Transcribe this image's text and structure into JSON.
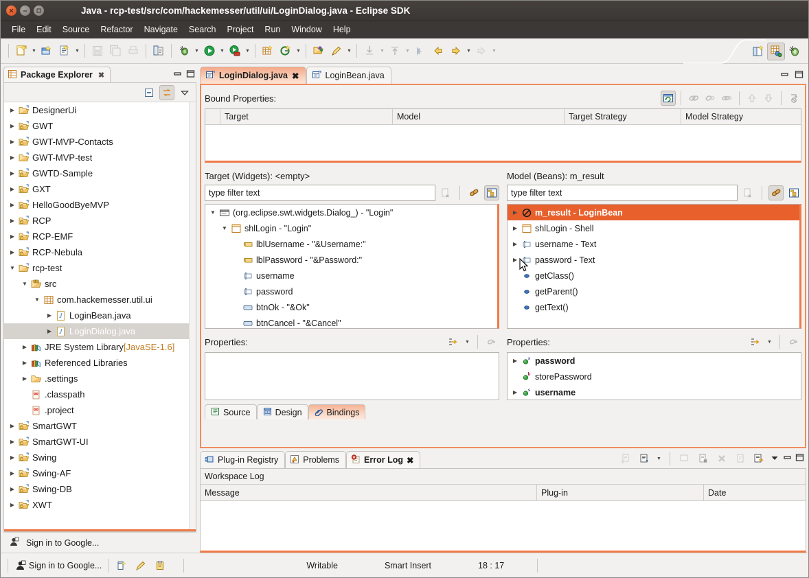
{
  "window": {
    "title": "Java - rcp-test/src/com/hackemesser/util/ui/LoginDialog.java - Eclipse SDK",
    "buttons": {
      "close": "close-window",
      "minimize": "minimize-window",
      "maximize": "maximize-window"
    }
  },
  "menubar": {
    "items": [
      "File",
      "Edit",
      "Source",
      "Refactor",
      "Navigate",
      "Search",
      "Project",
      "Run",
      "Window",
      "Help"
    ]
  },
  "toolbar": {
    "groups": [
      [
        "new-wizard",
        "new-wizard-dropdown",
        "new-java-package",
        "new-java-class",
        "new-java-class-dropdown"
      ],
      [
        "save",
        "save-all",
        "print"
      ],
      [
        "toggle-mark-occurrences"
      ],
      [
        "debug",
        "debug-dropdown",
        "run",
        "run-dropdown",
        "run-last-tool",
        "run-last-tool-dropdown"
      ],
      [
        "new-java-package-2",
        "new-annotation"
      ],
      [
        "open-type",
        "search",
        "search-dropdown"
      ],
      [
        "next-annotation",
        "next-annotation-dropdown",
        "previous-annotation",
        "previous-annotation-dropdown"
      ],
      [
        "back",
        "forward",
        "forward-dropdown"
      ]
    ],
    "right": [
      "open-perspective",
      "java-perspective-active",
      "debug-perspective"
    ]
  },
  "package_explorer": {
    "tab_label": "Package Explorer",
    "tab_icon": "package-explorer-icon",
    "close_icon": "close-icon",
    "minimize_icon": "minimize-icon",
    "maximize_icon": "maximize-icon",
    "toolbar": [
      "collapse-all-icon",
      "link-with-editor-icon",
      "view-menu-icon"
    ],
    "tree": [
      {
        "label": "DesignerUi",
        "icon": "project-open-icon",
        "indent": 0,
        "twisty": "collapsed",
        "selected": false
      },
      {
        "label": "GWT",
        "icon": "project-closed-icon",
        "indent": 0,
        "twisty": "collapsed",
        "selected": false
      },
      {
        "label": "GWT-MVP-Contacts",
        "icon": "project-closed-icon",
        "indent": 0,
        "twisty": "collapsed",
        "selected": false
      },
      {
        "label": "GWT-MVP-test",
        "icon": "project-open-icon",
        "indent": 0,
        "twisty": "collapsed",
        "selected": false
      },
      {
        "label": "GWTD-Sample",
        "icon": "project-closed-icon",
        "indent": 0,
        "twisty": "collapsed",
        "selected": false
      },
      {
        "label": "GXT",
        "icon": "project-closed-icon",
        "indent": 0,
        "twisty": "collapsed",
        "selected": false
      },
      {
        "label": "HelloGoodByeMVP",
        "icon": "project-closed-icon",
        "indent": 0,
        "twisty": "collapsed",
        "selected": false
      },
      {
        "label": "RCP",
        "icon": "project-closed-icon",
        "indent": 0,
        "twisty": "collapsed",
        "selected": false
      },
      {
        "label": "RCP-EMF",
        "icon": "project-closed-icon",
        "indent": 0,
        "twisty": "collapsed",
        "selected": false
      },
      {
        "label": "RCP-Nebula",
        "icon": "project-closed-icon",
        "indent": 0,
        "twisty": "collapsed",
        "selected": false
      },
      {
        "label": "rcp-test",
        "icon": "project-open-icon",
        "indent": 0,
        "twisty": "expanded",
        "selected": false
      },
      {
        "label": "src",
        "icon": "source-folder-icon",
        "indent": 1,
        "twisty": "expanded",
        "selected": false
      },
      {
        "label": "com.hackemesser.util.ui",
        "icon": "package-icon",
        "indent": 2,
        "twisty": "expanded",
        "selected": false
      },
      {
        "label": "LoginBean.java",
        "icon": "java-file-icon",
        "indent": 3,
        "twisty": "collapsed",
        "selected": false
      },
      {
        "label": "LoginDialog.java",
        "icon": "java-file-icon",
        "indent": 3,
        "twisty": "collapsed",
        "selected": true
      },
      {
        "label": "JRE System Library ",
        "suffix": "[JavaSE-1.6]",
        "icon": "library-icon",
        "indent": 1,
        "twisty": "collapsed",
        "selected": false
      },
      {
        "label": "Referenced Libraries",
        "icon": "library-icon",
        "indent": 1,
        "twisty": "collapsed",
        "selected": false
      },
      {
        "label": ".settings",
        "icon": "folder-icon",
        "indent": 1,
        "twisty": "collapsed",
        "selected": false
      },
      {
        "label": ".classpath",
        "icon": "file-icon",
        "indent": 1,
        "twisty": "none",
        "selected": false
      },
      {
        "label": ".project",
        "icon": "file-icon",
        "indent": 1,
        "twisty": "none",
        "selected": false
      },
      {
        "label": "SmartGWT",
        "icon": "project-closed-icon",
        "indent": 0,
        "twisty": "collapsed",
        "selected": false
      },
      {
        "label": "SmartGWT-UI",
        "icon": "project-closed-icon",
        "indent": 0,
        "twisty": "collapsed",
        "selected": false
      },
      {
        "label": "Swing",
        "icon": "project-closed-icon",
        "indent": 0,
        "twisty": "collapsed",
        "selected": false
      },
      {
        "label": "Swing-AF",
        "icon": "project-closed-icon",
        "indent": 0,
        "twisty": "collapsed",
        "selected": false
      },
      {
        "label": "Swing-DB",
        "icon": "project-closed-icon",
        "indent": 0,
        "twisty": "collapsed",
        "selected": false
      },
      {
        "label": "XWT",
        "icon": "project-closed-icon",
        "indent": 0,
        "twisty": "collapsed",
        "selected": false
      }
    ],
    "footer": {
      "signin_label": "Sign in to Google...",
      "icons": [
        "new-snippet-icon",
        "pencil-icon",
        "clipboard-icon"
      ]
    }
  },
  "editor": {
    "tabs": [
      {
        "label": "LoginDialog.java",
        "icon": "java-editor-icon",
        "active": true,
        "close_icon": "close-icon"
      },
      {
        "label": "LoginBean.java",
        "icon": "java-editor-icon",
        "active": false
      }
    ],
    "controls": [
      "minimize-icon",
      "maximize-icon"
    ],
    "bound_properties": {
      "label": "Bound Properties:",
      "toolbar": [
        "refresh-icon",
        "edit-binding-icon",
        "remove-binding-icon",
        "remove-all-bindings-icon",
        "move-up-icon",
        "move-down-icon",
        "jump-to-icon"
      ],
      "columns": [
        "Target",
        "Model",
        "Target Strategy",
        "Model Strategy"
      ],
      "rows": []
    },
    "target": {
      "title": "Target (Widgets): <empty>",
      "filter_placeholder": "type filter text",
      "filter_value": "",
      "filter_tools": [
        "clear-filter-icon",
        "show-advanced-properties-icon",
        "show-tree-icon"
      ],
      "tree": [
        {
          "label": "(org.eclipse.swt.widgets.Dialog_) - \"Login\"",
          "icon": "dialog-icon",
          "indent": 0,
          "twisty": "expanded"
        },
        {
          "label": "shlLogin - \"Login\"",
          "icon": "shell-icon",
          "indent": 1,
          "twisty": "expanded"
        },
        {
          "label": "lblUsername - \"&Username:\"",
          "icon": "label-widget-icon",
          "indent": 2,
          "twisty": "none"
        },
        {
          "label": "lblPassword - \"&Password:\"",
          "icon": "label-widget-icon",
          "indent": 2,
          "twisty": "none"
        },
        {
          "label": "username",
          "icon": "text-widget-icon",
          "indent": 2,
          "twisty": "none"
        },
        {
          "label": "password",
          "icon": "text-widget-icon",
          "indent": 2,
          "twisty": "none"
        },
        {
          "label": "btnOk - \"&Ok\"",
          "icon": "button-widget-icon",
          "indent": 2,
          "twisty": "none"
        },
        {
          "label": "btnCancel - \"&Cancel\"",
          "icon": "button-widget-icon",
          "indent": 2,
          "twisty": "none"
        }
      ],
      "properties_label": "Properties:",
      "properties_tools": [
        "filter-properties-icon",
        "bind-icon"
      ],
      "properties": []
    },
    "model": {
      "title": "Model (Beans): m_result",
      "filter_placeholder": "type filter text",
      "filter_value": "",
      "filter_tools": [
        "clear-filter-icon",
        "show-advanced-properties-icon",
        "show-tree-icon"
      ],
      "tree": [
        {
          "label": "m_result - LoginBean",
          "icon": "bean-icon",
          "indent": 0,
          "twisty": "collapsed",
          "selected": true
        },
        {
          "label": "shlLogin - Shell",
          "icon": "shell-icon",
          "indent": 0,
          "twisty": "collapsed",
          "selected": false
        },
        {
          "label": "username - Text",
          "icon": "text-widget-icon",
          "indent": 0,
          "twisty": "collapsed",
          "selected": false
        },
        {
          "label": "password - Text",
          "icon": "text-widget-icon",
          "indent": 0,
          "twisty": "collapsed",
          "selected": false
        },
        {
          "label": "getClass()",
          "icon": "method-icon",
          "indent": 0,
          "twisty": "none",
          "selected": false
        },
        {
          "label": "getParent()",
          "icon": "method-icon",
          "indent": 0,
          "twisty": "none",
          "selected": false
        },
        {
          "label": "getText()",
          "icon": "method-icon",
          "indent": 0,
          "twisty": "none",
          "selected": false
        }
      ],
      "properties_label": "Properties:",
      "properties_tools": [
        "filter-properties-icon",
        "bind-icon"
      ],
      "properties": [
        {
          "label": "password",
          "icon": "property-string-icon",
          "badge": "s",
          "bold": true,
          "twisty": "collapsed"
        },
        {
          "label": "storePassword",
          "icon": "property-boolean-icon",
          "badge": "b",
          "bold": false,
          "twisty": "none"
        },
        {
          "label": "username",
          "icon": "property-string-icon",
          "badge": "s",
          "bold": true,
          "twisty": "collapsed"
        }
      ]
    },
    "bottom_tabs": [
      {
        "label": "Source",
        "icon": "source-tab-icon",
        "active": false
      },
      {
        "label": "Design",
        "icon": "design-tab-icon",
        "active": false
      },
      {
        "label": "Bindings",
        "icon": "bindings-tab-icon",
        "active": true
      }
    ]
  },
  "bottom_view": {
    "tabs": [
      {
        "label": "Plug-in Registry",
        "icon": "plugin-registry-icon",
        "active": false
      },
      {
        "label": "Problems",
        "icon": "problems-icon",
        "active": false
      },
      {
        "label": "Error Log",
        "icon": "error-log-icon",
        "active": true,
        "close_icon": "close-icon"
      }
    ],
    "toolbar": [
      "export-log-icon",
      "import-log-icon",
      "import-log-dropdown",
      "open-log-icon",
      "clear-log-icon",
      "delete-log-icon",
      "restore-log-icon",
      "open-log-file-icon",
      "view-menu-icon",
      "minimize-icon",
      "maximize-icon"
    ],
    "workspace_log_label": "Workspace Log",
    "columns": [
      "Message",
      "Plug-in",
      "Date"
    ],
    "rows": []
  },
  "statusbar": {
    "signin_label": "Sign in to Google...",
    "icons": [
      "new-snippet-icon",
      "pencil-icon",
      "clipboard-icon"
    ],
    "writable": "Writable",
    "insert_mode": "Smart Insert",
    "position": "18 : 17"
  },
  "colors": {
    "accent_orange": "#ef7a49",
    "selection_orange": "#e8602c",
    "titlebar": "#3c3835",
    "chrome": "#f2f1f0"
  }
}
